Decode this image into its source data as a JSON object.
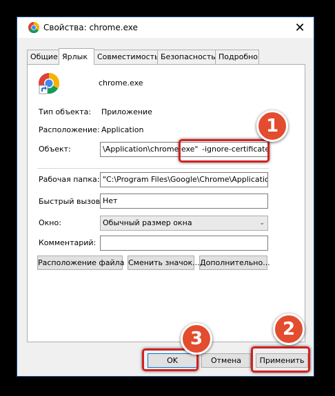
{
  "window": {
    "title": "Свойства: chrome.exe",
    "close_icon": "close-icon"
  },
  "tabs": [
    {
      "label": "Общие"
    },
    {
      "label": "Ярлык",
      "active": true
    },
    {
      "label": "Совместимость"
    },
    {
      "label": "Безопасность"
    },
    {
      "label": "Подробно"
    }
  ],
  "shortcut": {
    "app_name": "chrome.exe",
    "type_label": "Тип объекта:",
    "type_value": "Приложение",
    "location_label": "Расположение:",
    "location_value": "Application",
    "target_label": "Объект:",
    "target_value_visible": "\\Application\\chrome.exe\"",
    "target_value_arg": "-ignore-certificate-errors",
    "start_in_label": "Рабочая папка:",
    "start_in_value": "\"C:\\Program Files\\Google\\Chrome\\Application\"",
    "hotkey_label": "Быстрый вызов:",
    "hotkey_value": "Нет",
    "run_label": "Окно:",
    "run_value": "Обычный размер окна",
    "comment_label": "Комментарий:",
    "comment_value": ""
  },
  "buttons": {
    "open_location": "Расположение файла",
    "change_icon": "Сменить значок...",
    "advanced": "Дополнительно...",
    "ok": "OK",
    "cancel": "Отмена",
    "apply": "Применить"
  },
  "annotations": {
    "badge1": "1",
    "badge2": "2",
    "badge3": "3",
    "color": "#d32020"
  },
  "colors": {
    "accent": "#0078d7",
    "badge": "#e34c2e"
  }
}
